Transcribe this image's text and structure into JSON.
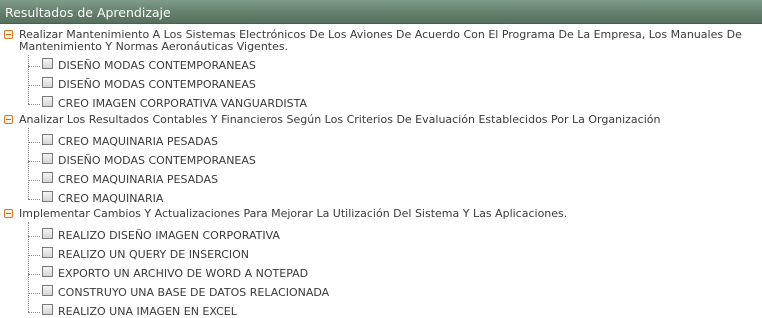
{
  "header": {
    "title": "Resultados de Aprendizaje"
  },
  "groups": [
    {
      "label": "Realizar Mantenimiento A Los Sistemas Electrónicos De Los Aviones De Acuerdo Con El Programa De La Empresa, Los Manuales De Mantenimiento Y Normas Aeronáuticas Vigentes.",
      "expanded": true,
      "items": [
        {
          "label": "DISEÑO MODAS CONTEMPORANEAS",
          "checked": false
        },
        {
          "label": "DISEÑO MODAS CONTEMPORANEAS",
          "checked": false
        },
        {
          "label": "CREO IMAGEN CORPORATIVA VANGUARDISTA",
          "checked": false
        }
      ]
    },
    {
      "label": "Analizar Los Resultados Contables Y Financieros Según Los Criterios De Evaluación Establecidos Por La Organización",
      "expanded": true,
      "items": [
        {
          "label": "CREO MAQUINARIA PESADAS",
          "checked": false
        },
        {
          "label": "DISEÑO MODAS CONTEMPORANEAS",
          "checked": false
        },
        {
          "label": "CREO MAQUINARIA PESADAS",
          "checked": false
        },
        {
          "label": "CREO MAQUINARIA",
          "checked": false
        }
      ]
    },
    {
      "label": "Implementar Cambios Y Actualizaciones Para Mejorar La Utilización Del Sistema Y Las Aplicaciones.",
      "expanded": true,
      "items": [
        {
          "label": "REALIZO DISEÑO IMAGEN CORPORATIVA",
          "checked": false
        },
        {
          "label": "REALIZO UN QUERY DE INSERCION",
          "checked": false
        },
        {
          "label": "EXPORTO UN ARCHIVO DE WORD A NOTEPAD",
          "checked": false
        },
        {
          "label": "CONSTRUYO UNA BASE DE DATOS RELACIONADA",
          "checked": false
        },
        {
          "label": "REALIZO UNA IMAGEN EN EXCEL",
          "checked": false
        }
      ]
    }
  ],
  "colors": {
    "header_bg": "#647f6c",
    "toggle_border": "#d07a24"
  },
  "icons": {
    "toggle": "minus-icon",
    "checkbox": "checkbox-icon"
  }
}
